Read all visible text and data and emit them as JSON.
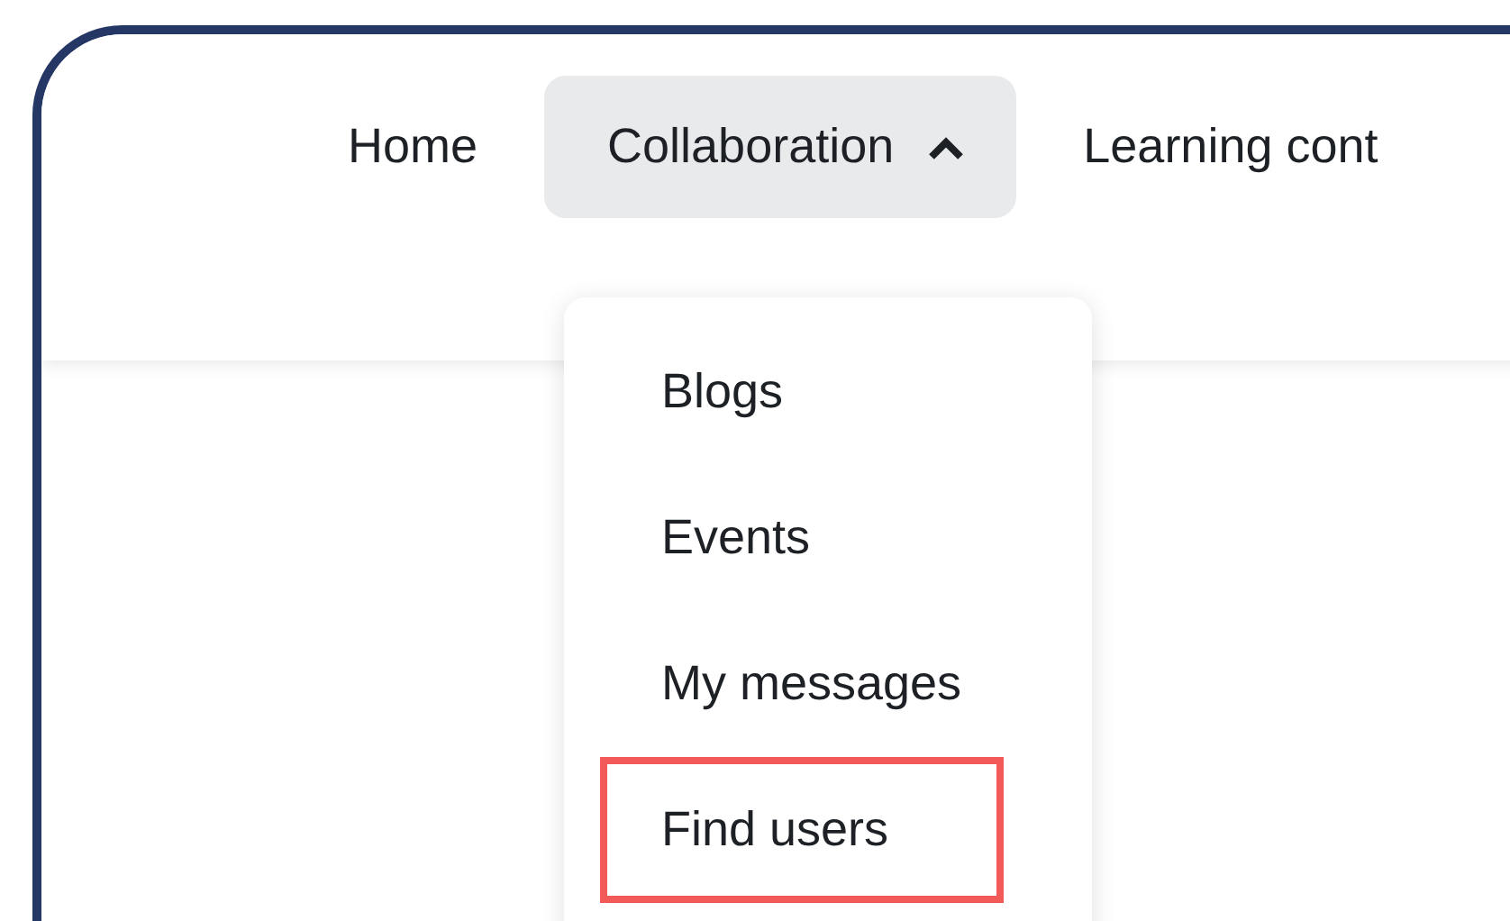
{
  "nav": {
    "items": [
      {
        "label": "Home",
        "selected": false,
        "has_menu": false
      },
      {
        "label": "Collaboration",
        "selected": true,
        "has_menu": true
      },
      {
        "label": "Learning cont",
        "selected": false,
        "has_menu": false
      }
    ]
  },
  "dropdown": {
    "items": [
      {
        "label": "Blogs",
        "highlighted": false
      },
      {
        "label": "Events",
        "highlighted": false
      },
      {
        "label": "My messages",
        "highlighted": false
      },
      {
        "label": "Find users",
        "highlighted": true
      }
    ]
  }
}
